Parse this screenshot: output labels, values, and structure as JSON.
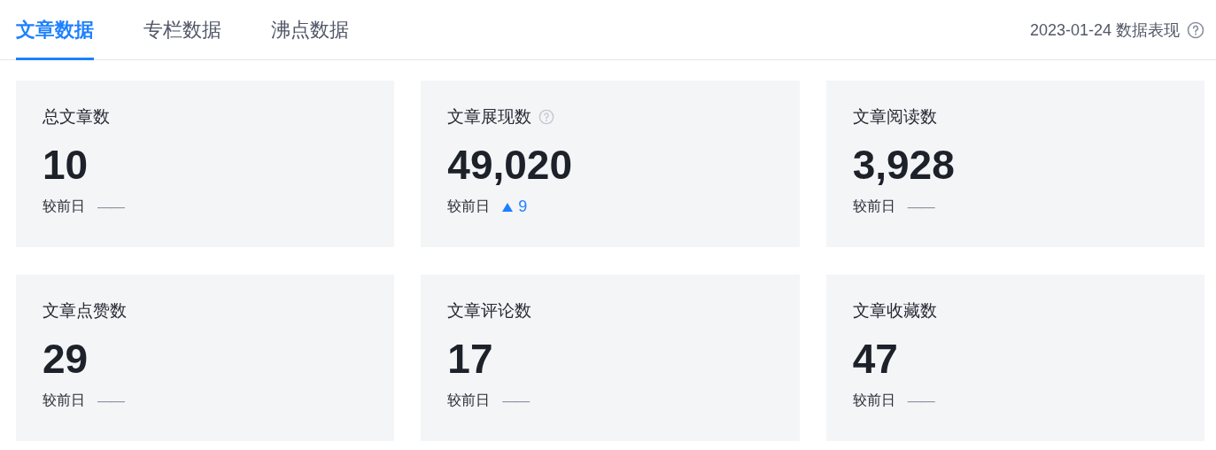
{
  "tabs": [
    {
      "label": "文章数据",
      "selected": true
    },
    {
      "label": "专栏数据",
      "selected": false
    },
    {
      "label": "沸点数据",
      "selected": false
    }
  ],
  "summary": {
    "label": "2023-01-24 数据表现",
    "help": true
  },
  "cards": [
    {
      "title": "总文章数",
      "help": false,
      "value": "10",
      "compare_label": "较前日",
      "kind": "flat",
      "change": "——"
    },
    {
      "title": "文章展现数",
      "help": true,
      "value": "49,020",
      "compare_label": "较前日",
      "kind": "up",
      "change": "9"
    },
    {
      "title": "文章阅读数",
      "help": false,
      "value": "3,928",
      "compare_label": "较前日",
      "kind": "flat",
      "change": "——"
    },
    {
      "title": "文章点赞数",
      "help": false,
      "value": "29",
      "compare_label": "较前日",
      "kind": "flat",
      "change": "——"
    },
    {
      "title": "文章评论数",
      "help": false,
      "value": "17",
      "compare_label": "较前日",
      "kind": "flat",
      "change": "——"
    },
    {
      "title": "文章收藏数",
      "help": false,
      "value": "47",
      "compare_label": "较前日",
      "kind": "flat",
      "change": "——"
    }
  ]
}
